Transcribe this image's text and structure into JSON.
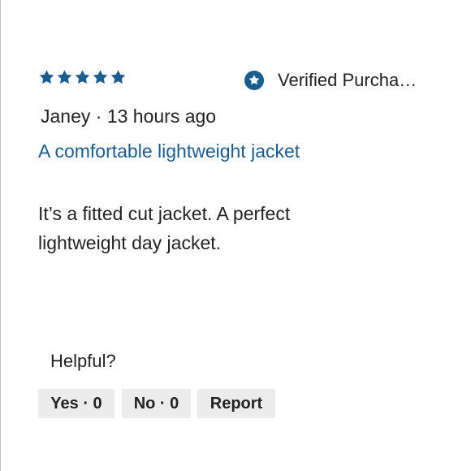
{
  "review": {
    "rating": 5,
    "star_color": "#1a5d8f",
    "verified_icon": "verified-star-badge-icon",
    "verified_label": "Verified Purcha…",
    "author": "Janey",
    "separator": "·",
    "time_ago": "13 hours ago",
    "title": "A comfortable lightweight jacket",
    "body": "It’s a fitted cut jacket. A perfect lightweight day jacket."
  },
  "feedback": {
    "helpful_label": "Helpful?",
    "yes_label": "Yes · 0",
    "no_label": "No · 0",
    "report_label": "Report"
  }
}
